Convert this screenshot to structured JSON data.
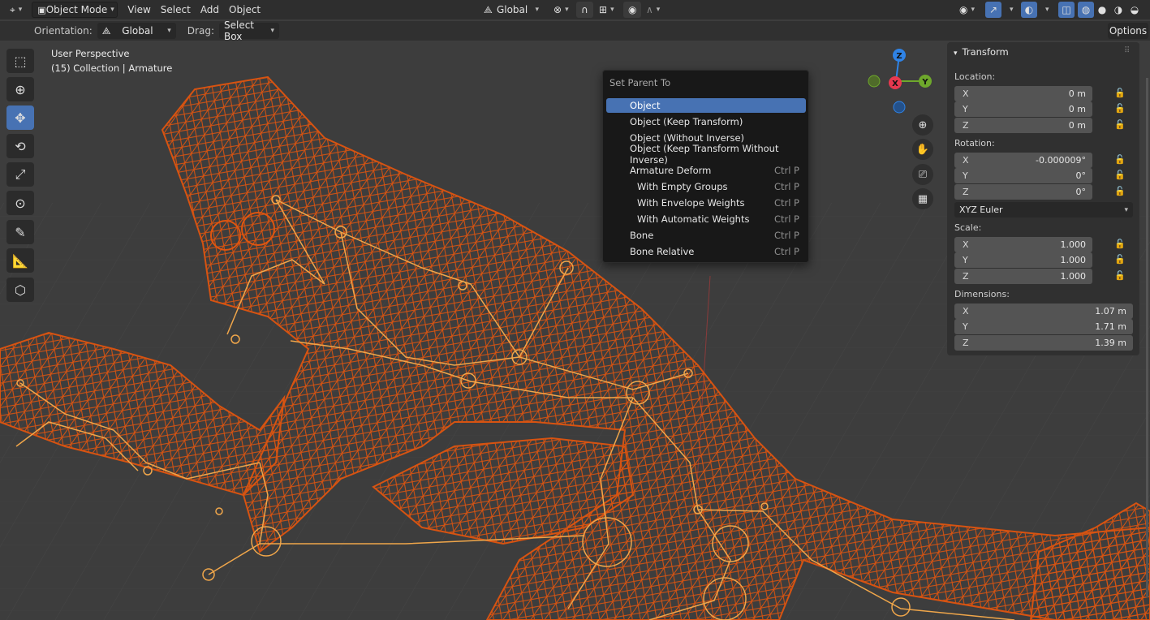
{
  "header": {
    "mode": "Object Mode",
    "menus": [
      "View",
      "Select",
      "Add",
      "Object"
    ],
    "transform_orientation": "Global",
    "options_label": "Options"
  },
  "tool_settings": {
    "orientation_label": "Orientation:",
    "orientation_value": "Global",
    "drag_label": "Drag:",
    "drag_value": "Select Box"
  },
  "viewport": {
    "perspective": "User Perspective",
    "collection": "(15) Collection | Armature"
  },
  "gizmo": {
    "x": "X",
    "y": "Y",
    "z": "Z"
  },
  "menu": {
    "title": "Set Parent To",
    "items": [
      {
        "label": "Object",
        "shortcut": "",
        "highlighted": true,
        "sub": false
      },
      {
        "label": "Object (Keep Transform)",
        "shortcut": "",
        "sub": false
      },
      {
        "label": "Object (Without Inverse)",
        "shortcut": "",
        "sub": false
      },
      {
        "label": "Object (Keep Transform Without Inverse)",
        "shortcut": "",
        "sub": false
      },
      {
        "label": "Armature Deform",
        "shortcut": "Ctrl P",
        "sub": false
      },
      {
        "label": "With Empty Groups",
        "shortcut": "Ctrl P",
        "sub": true
      },
      {
        "label": "With Envelope Weights",
        "shortcut": "Ctrl P",
        "sub": true
      },
      {
        "label": "With Automatic Weights",
        "shortcut": "Ctrl P",
        "sub": true
      },
      {
        "label": "Bone",
        "shortcut": "Ctrl P",
        "sub": false
      },
      {
        "label": "Bone Relative",
        "shortcut": "Ctrl P",
        "sub": false
      }
    ]
  },
  "transform": {
    "title": "Transform",
    "location_label": "Location:",
    "location": [
      {
        "axis": "X",
        "value": "0 m"
      },
      {
        "axis": "Y",
        "value": "0 m"
      },
      {
        "axis": "Z",
        "value": "0 m"
      }
    ],
    "rotation_label": "Rotation:",
    "rotation": [
      {
        "axis": "X",
        "value": "-0.000009°"
      },
      {
        "axis": "Y",
        "value": "0°"
      },
      {
        "axis": "Z",
        "value": "0°"
      }
    ],
    "rotation_mode": "XYZ Euler",
    "scale_label": "Scale:",
    "scale": [
      {
        "axis": "X",
        "value": "1.000"
      },
      {
        "axis": "Y",
        "value": "1.000"
      },
      {
        "axis": "Z",
        "value": "1.000"
      }
    ],
    "dimensions_label": "Dimensions:",
    "dimensions": [
      {
        "axis": "X",
        "value": "1.07 m"
      },
      {
        "axis": "Y",
        "value": "1.71 m"
      },
      {
        "axis": "Z",
        "value": "1.39 m"
      }
    ]
  },
  "colors": {
    "mesh": "#e0550f",
    "bone": "#f0a64a",
    "highlight": "#4772b3",
    "axis_x": "#e8384f",
    "axis_y": "#6ea82c",
    "axis_z": "#2f83e6"
  }
}
